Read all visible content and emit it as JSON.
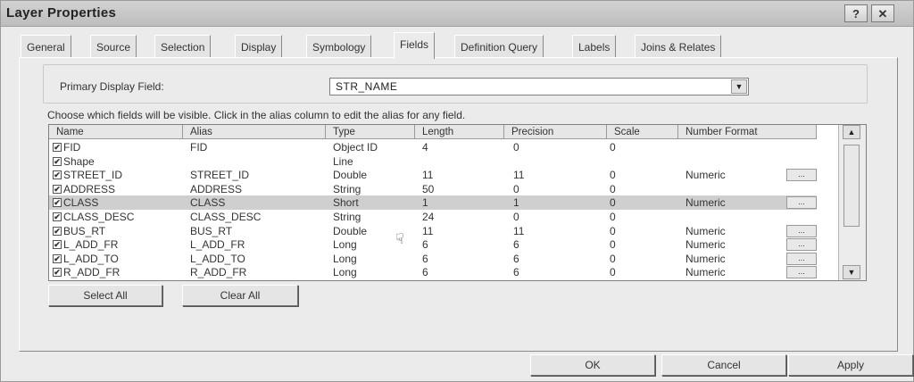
{
  "window": {
    "title": "Layer Properties",
    "help_label": "?",
    "close_label": "✕"
  },
  "tabs": [
    "General",
    "Source",
    "Selection",
    "Display",
    "Symbology",
    "Fields",
    "Definition Query",
    "Labels",
    "Joins & Relates"
  ],
  "active_tab": "Fields",
  "primary_display": {
    "label": "Primary Display Field:",
    "value": "STR_NAME"
  },
  "instructions": "Choose which fields will be visible. Click in the alias column to edit the alias for any field.",
  "columns": [
    "Name",
    "Alias",
    "Type",
    "Length",
    "Precision",
    "Scale",
    "Number Format"
  ],
  "rows": [
    {
      "name": "FID",
      "alias": "FID",
      "type": "Object ID",
      "length": "4",
      "precision": "0",
      "scale": "0",
      "format": "",
      "has_button": false
    },
    {
      "name": "Shape",
      "alias": "",
      "type": "Line",
      "length": "",
      "precision": "",
      "scale": "",
      "format": "",
      "has_button": false
    },
    {
      "name": "STREET_ID",
      "alias": "STREET_ID",
      "type": "Double",
      "length": "11",
      "precision": "11",
      "scale": "0",
      "format": "Numeric",
      "has_button": true
    },
    {
      "name": "ADDRESS",
      "alias": "ADDRESS",
      "type": "String",
      "length": "50",
      "precision": "0",
      "scale": "0",
      "format": "",
      "has_button": false
    },
    {
      "name": "CLASS",
      "alias": "CLASS",
      "type": "Short",
      "length": "1",
      "precision": "1",
      "scale": "0",
      "format": "Numeric",
      "has_button": true,
      "selected": true
    },
    {
      "name": "CLASS_DESC",
      "alias": "CLASS_DESC",
      "type": "String",
      "length": "24",
      "precision": "0",
      "scale": "0",
      "format": "",
      "has_button": false
    },
    {
      "name": "BUS_RT",
      "alias": "BUS_RT",
      "type": "Double",
      "length": "11",
      "precision": "11",
      "scale": "0",
      "format": "Numeric",
      "has_button": true
    },
    {
      "name": "L_ADD_FR",
      "alias": "L_ADD_FR",
      "type": "Long",
      "length": "6",
      "precision": "6",
      "scale": "0",
      "format": "Numeric",
      "has_button": true
    },
    {
      "name": "L_ADD_TO",
      "alias": "L_ADD_TO",
      "type": "Long",
      "length": "6",
      "precision": "6",
      "scale": "0",
      "format": "Numeric",
      "has_button": true
    },
    {
      "name": "R_ADD_FR",
      "alias": "R_ADD_FR",
      "type": "Long",
      "length": "6",
      "precision": "6",
      "scale": "0",
      "format": "Numeric",
      "has_button": true
    }
  ],
  "buttons": {
    "select_all": "Select All",
    "clear_all": "Clear All",
    "ok": "OK",
    "cancel": "Cancel",
    "apply": "Apply",
    "ellipsis": "..."
  },
  "check_glyph": "✔"
}
